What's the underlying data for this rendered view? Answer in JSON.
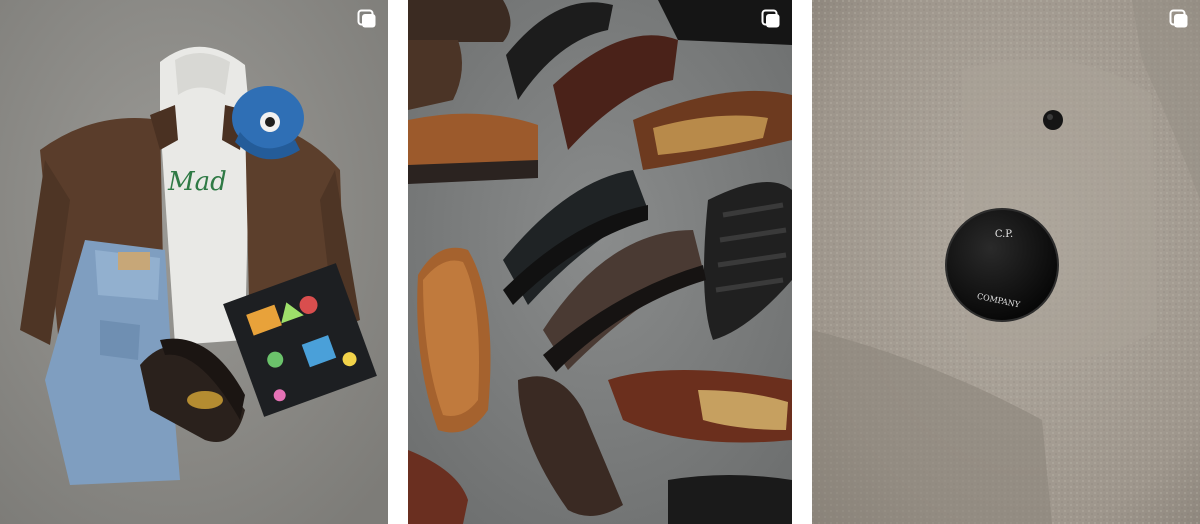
{
  "feed": {
    "posts": [
      {
        "badge_icon": "multiple-images-icon",
        "bg_color": "#8f8e8a",
        "visible_texts": [
          "Mad"
        ]
      },
      {
        "badge_icon": "multiple-images-icon",
        "bg_color": "#7e8080",
        "visible_texts": []
      },
      {
        "badge_icon": "multiple-images-icon",
        "bg_color": "#a59d93",
        "visible_texts": [
          "C.P.",
          "COMPANY"
        ]
      }
    ]
  }
}
